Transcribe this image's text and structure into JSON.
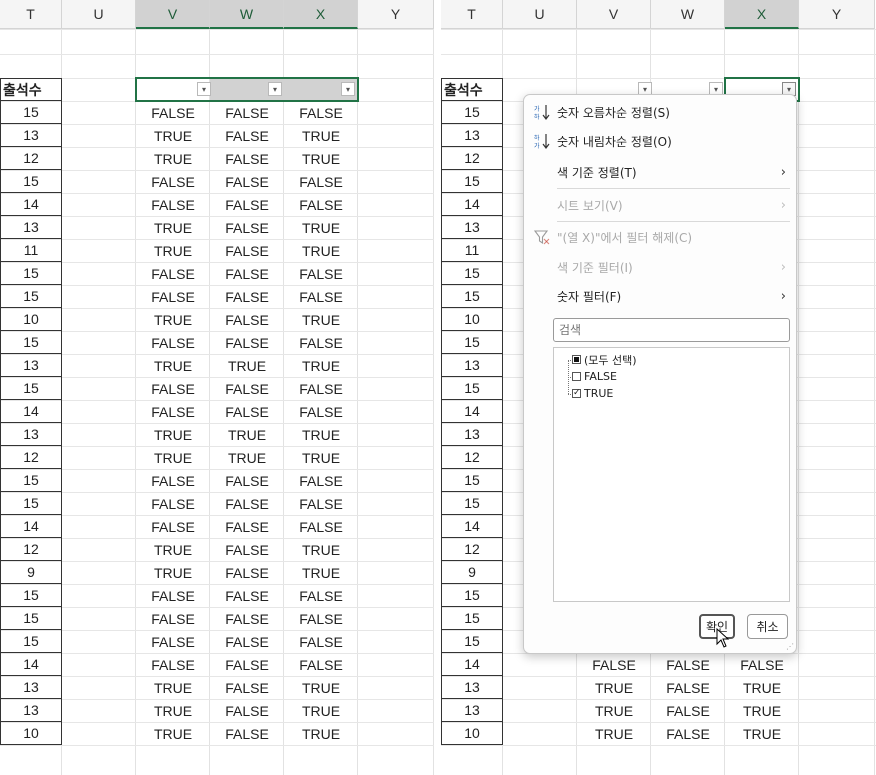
{
  "columns_left": [
    "T",
    "U",
    "V",
    "W",
    "X",
    "Y"
  ],
  "columns_right": [
    "T",
    "U",
    "V",
    "W",
    "X",
    "Y"
  ],
  "header_label": "출석수",
  "attendance": [
    15,
    13,
    12,
    15,
    14,
    13,
    11,
    15,
    15,
    10,
    15,
    13,
    15,
    14,
    13,
    12,
    15,
    15,
    14,
    12,
    9,
    15,
    15,
    15,
    14,
    13,
    13,
    10
  ],
  "col_v": [
    "FALSE",
    "TRUE",
    "TRUE",
    "FALSE",
    "FALSE",
    "TRUE",
    "TRUE",
    "FALSE",
    "FALSE",
    "TRUE",
    "FALSE",
    "TRUE",
    "FALSE",
    "FALSE",
    "TRUE",
    "TRUE",
    "FALSE",
    "FALSE",
    "FALSE",
    "TRUE",
    "TRUE",
    "FALSE",
    "FALSE",
    "FALSE",
    "FALSE",
    "TRUE",
    "TRUE",
    "TRUE"
  ],
  "col_w": [
    "FALSE",
    "FALSE",
    "FALSE",
    "FALSE",
    "FALSE",
    "FALSE",
    "FALSE",
    "FALSE",
    "FALSE",
    "FALSE",
    "FALSE",
    "TRUE",
    "FALSE",
    "FALSE",
    "TRUE",
    "TRUE",
    "FALSE",
    "FALSE",
    "FALSE",
    "FALSE",
    "FALSE",
    "FALSE",
    "FALSE",
    "FALSE",
    "FALSE",
    "FALSE",
    "FALSE",
    "FALSE"
  ],
  "col_x": [
    "FALSE",
    "TRUE",
    "TRUE",
    "FALSE",
    "FALSE",
    "TRUE",
    "TRUE",
    "FALSE",
    "FALSE",
    "TRUE",
    "FALSE",
    "TRUE",
    "FALSE",
    "FALSE",
    "TRUE",
    "TRUE",
    "FALSE",
    "FALSE",
    "FALSE",
    "TRUE",
    "TRUE",
    "FALSE",
    "FALSE",
    "FALSE",
    "FALSE",
    "TRUE",
    "TRUE",
    "TRUE"
  ],
  "filter_menu": {
    "sort_asc": "숫자 오름차순 정렬(S)",
    "sort_desc": "숫자 내림차순 정렬(O)",
    "sort_by_color": "색 기준 정렬(T)",
    "sheet_view": "시트 보기(V)",
    "clear_filter": "\"(열 X)\"에서 필터 해제(C)",
    "filter_by_color": "색 기준 필터(I)",
    "number_filter": "숫자 필터(F)",
    "search_placeholder": "검색",
    "items": [
      {
        "label": "(모두 선택)",
        "state": "partial"
      },
      {
        "label": "FALSE",
        "state": "unchecked"
      },
      {
        "label": "TRUE",
        "state": "checked"
      }
    ],
    "ok_label": "확인",
    "cancel_label": "취소"
  },
  "colors": {
    "accent": "#217346",
    "selected_header": "#d2d2d2",
    "header_bg": "#f5f5f5"
  }
}
